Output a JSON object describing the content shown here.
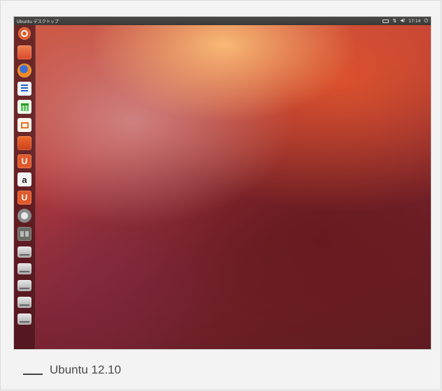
{
  "desktop": {
    "panel_title": "Ubuntu デスクトップ",
    "clock": "17:14",
    "indicators": {
      "keyboard_icon": "keyboard-icon",
      "network_icon": "network-updown-icon",
      "network_glyph": "⇅",
      "volume_icon": "volume-icon",
      "volume_glyph": "◀)",
      "power_icon": "power-icon",
      "power_glyph": "⏻"
    },
    "launcher": [
      {
        "name": "ubuntu-dash-icon"
      },
      {
        "name": "files-folder-icon"
      },
      {
        "name": "firefox-icon"
      },
      {
        "name": "libreoffice-writer-icon"
      },
      {
        "name": "libreoffice-calc-icon"
      },
      {
        "name": "libreoffice-impress-icon"
      },
      {
        "name": "software-center-icon"
      },
      {
        "name": "ubuntu-one-icon",
        "glyph": "U"
      },
      {
        "name": "amazon-icon",
        "glyph": "a"
      },
      {
        "name": "ubuntu-one-music-icon",
        "glyph": "U"
      },
      {
        "name": "system-settings-icon"
      },
      {
        "name": "workspace-switcher-icon"
      },
      {
        "name": "drive-icon"
      },
      {
        "name": "drive-icon"
      },
      {
        "name": "drive-icon"
      },
      {
        "name": "drive-icon"
      },
      {
        "name": "trash-icon"
      }
    ]
  },
  "caption": {
    "text": "Ubuntu 12.10"
  },
  "colors": {
    "accent": "#e05a2b",
    "panel": "#3c3b37"
  }
}
